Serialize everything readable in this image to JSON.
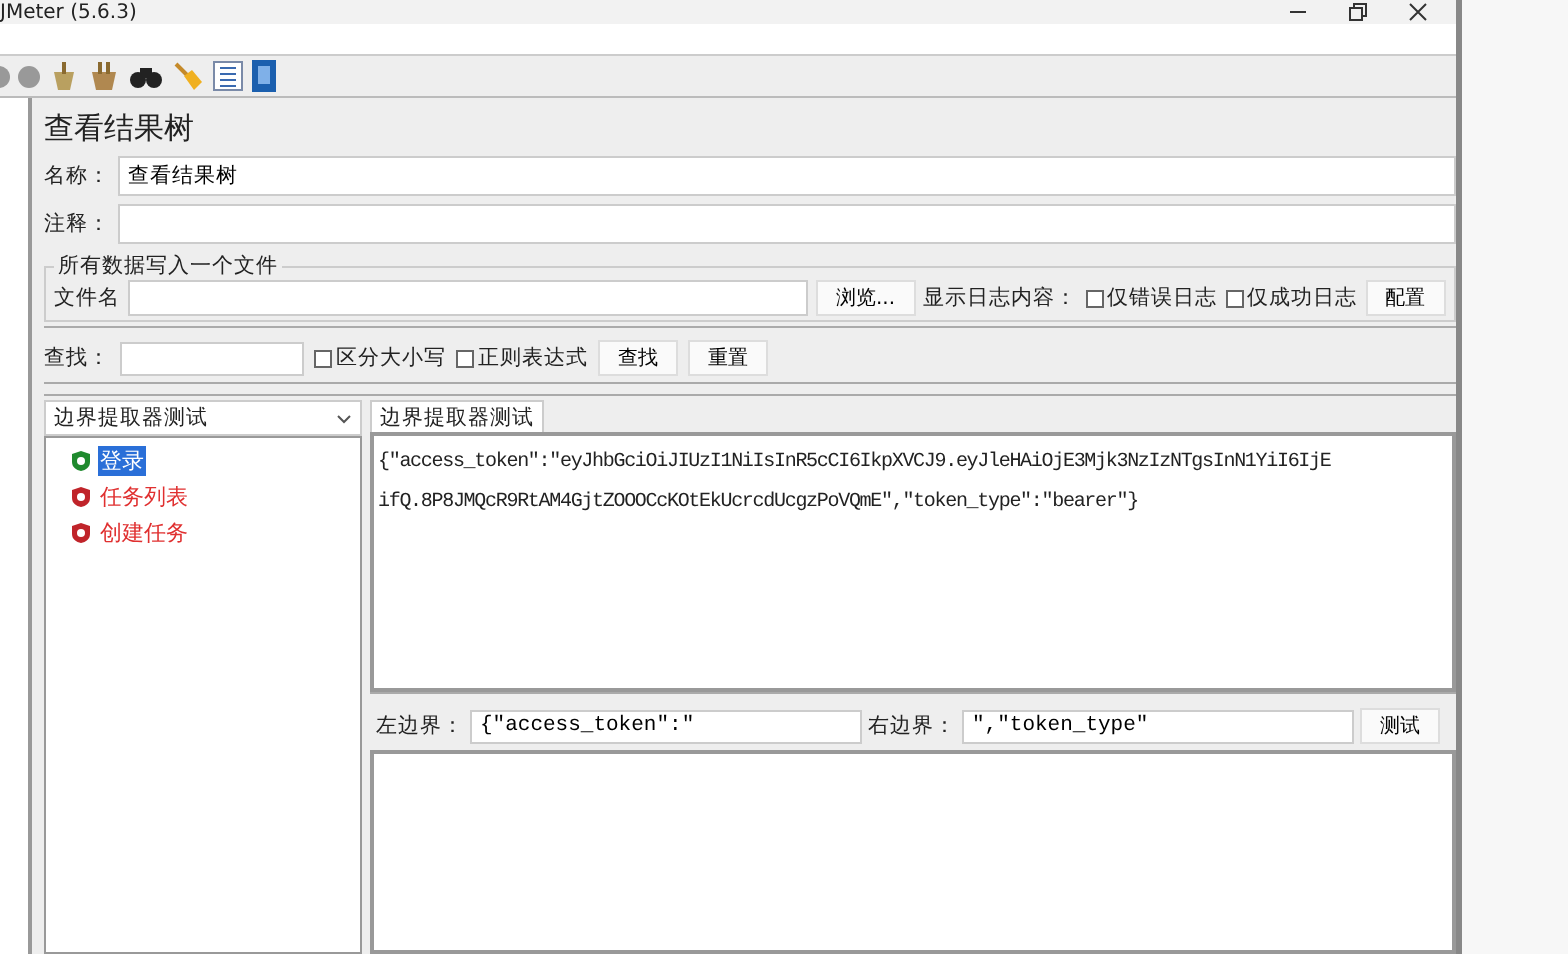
{
  "window": {
    "title": "JMeter (5.6.3)"
  },
  "panel": {
    "title": "查看结果树",
    "name_label": "名称：",
    "name_value": "查看结果树",
    "comment_label": "注释："
  },
  "file_section": {
    "legend": "所有数据写入一个文件",
    "file_label": "文件名",
    "browse": "浏览...",
    "log_label": "显示日志内容：",
    "errors_only": {
      "label": "仅错误日志",
      "checked": false
    },
    "success_only": {
      "label": "仅成功日志",
      "checked": false
    },
    "configure": "配置"
  },
  "search": {
    "label": "查找：",
    "case_sensitive": {
      "label": "区分大小写",
      "checked": false
    },
    "regex": {
      "label": "正则表达式",
      "checked": false
    },
    "find": "查找",
    "reset": "重置"
  },
  "renderer": {
    "value": "边界提取器测试"
  },
  "tree": [
    {
      "label": "登录",
      "kind": "success",
      "selected": true
    },
    {
      "label": "任务列表",
      "kind": "error",
      "selected": false
    },
    {
      "label": "创建任务",
      "kind": "error",
      "selected": false
    }
  ],
  "tab": {
    "label": "边界提取器测试",
    "selected": true
  },
  "response_lines": [
    "{\"access_token\":\"eyJhbGciOiJIUzI1NiIsInR5cCI6IkpXVCJ9.eyJleHAiOjE3Mjk3NzIzNTgsInN1YiI6IjE",
    "ifQ.8P8JMQcR9RtAM4GjtZOOOCcKOtEkUcrcdUcgzPoVQmE\",\"token_type\":\"bearer\"}"
  ],
  "boundary": {
    "left_label": "左边界：",
    "left_value": "{\"access_token\":\"",
    "right_label": "右边界：",
    "right_value": "\",\"token_type\"",
    "test": "测试"
  }
}
